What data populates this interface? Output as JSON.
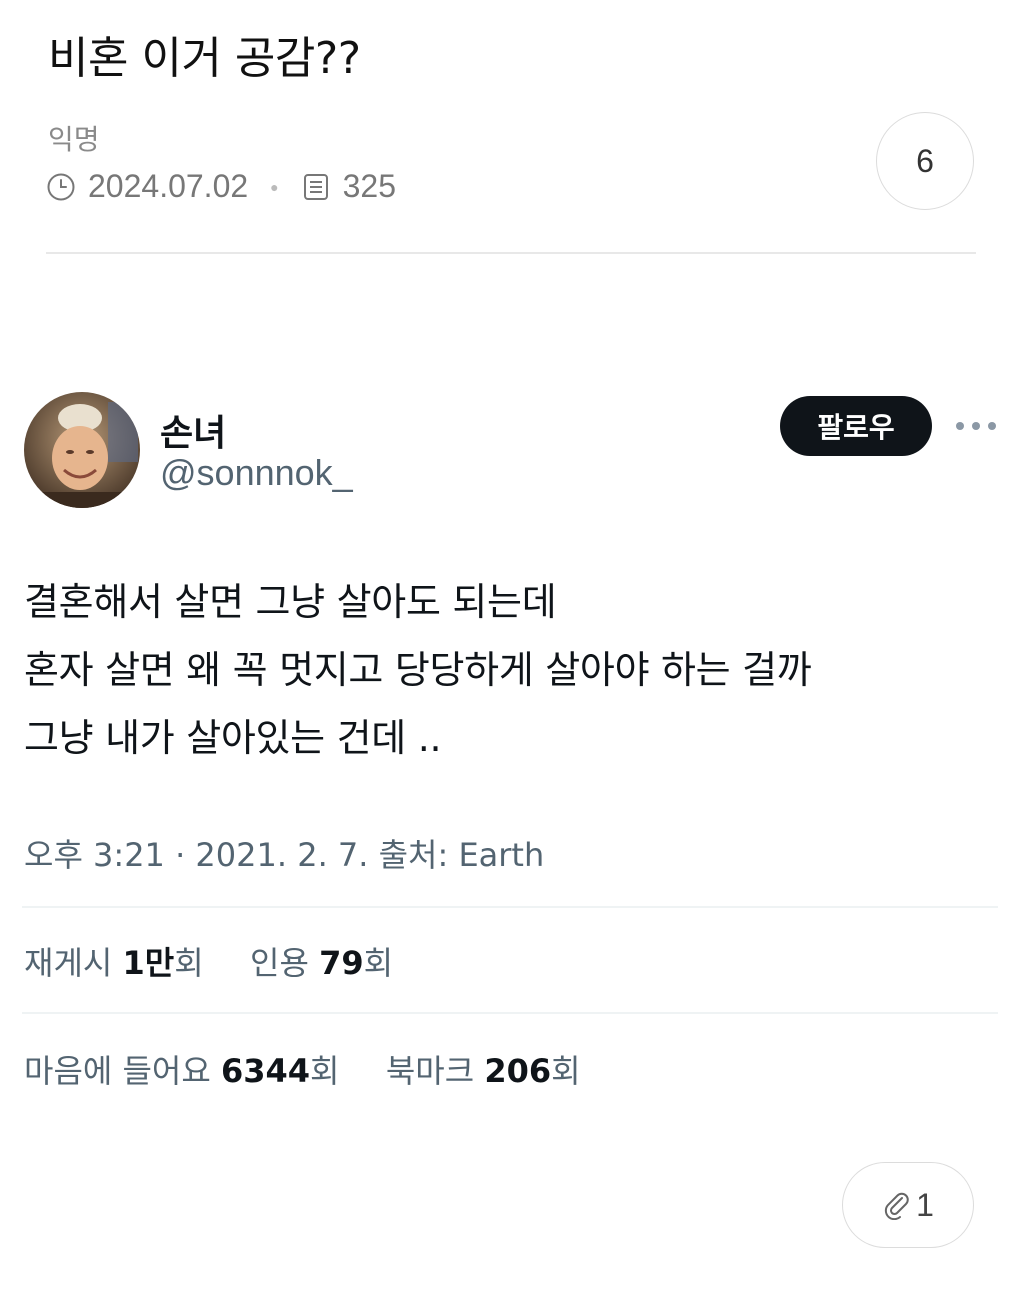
{
  "post": {
    "title": "비혼 이거 공감??",
    "author": "익명",
    "date": "2024.07.02",
    "views": "325",
    "comment_count": "6",
    "attachment_count": "1"
  },
  "tweet": {
    "display_name": "손녀",
    "handle": "@sonnnok_",
    "follow_label": "팔로우",
    "lines": [
      "결혼해서 살면 그냥 살아도 되는데",
      "혼자 살면 왜 꼭 멋지고 당당하게 살아야 하는 걸까",
      "그냥 내가 살아있는 건데  .."
    ],
    "timestamp": "오후 3:21 · 2021. 2. 7. 출처: Earth",
    "retweets_label": "재게시",
    "retweets_value": "1만",
    "retweets_unit": "회",
    "quotes_label": "인용",
    "quotes_value": "79",
    "quotes_unit": "회",
    "likes_label": "마음에 들어요",
    "likes_value": "6344",
    "likes_unit": "회",
    "bookmarks_label": "북마크",
    "bookmarks_value": "206",
    "bookmarks_unit": "회"
  },
  "icons": {
    "date": "clock-icon",
    "views": "document-icon",
    "more": "more-horizontal-icon",
    "attachment": "paperclip-icon"
  }
}
